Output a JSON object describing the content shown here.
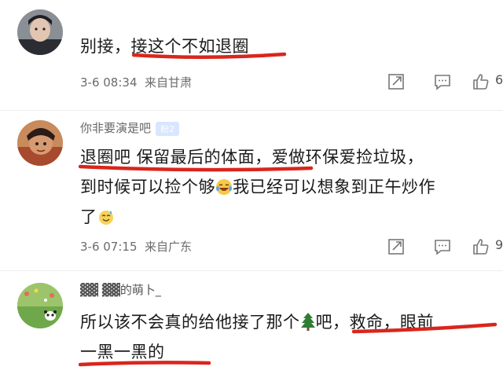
{
  "comments": [
    {
      "username": "",
      "text_lines": [
        "别接，接这个不如退圈"
      ],
      "time": "3-6 08:34",
      "location": "来自甘肃",
      "likes": "6"
    },
    {
      "username": "你非要演是吧",
      "fan_badge": "粉2",
      "text_lines": [
        "退圈吧 保留最后的体面，爱做环保爱捡垃圾，",
        "到时候可以捡个够",
        "我已经可以想象到正午炒作",
        "了"
      ],
      "time": "3-6 07:15",
      "location": "来自广东",
      "likes": "9"
    },
    {
      "username": "▓▓ ▓▓的萌卜_",
      "text_lines": [
        "所以该不会真的给他接了那个",
        "吧，救命，眼前",
        "一黑一黑的"
      ]
    }
  ],
  "colors": {
    "underline_red": "#d9261c",
    "meta_gray": "#6b6b6b",
    "text_dark": "#1a1a1a"
  },
  "icons": [
    "share-icon",
    "comment-icon",
    "like-icon",
    "laugh-cry-emoji",
    "tree-emoji"
  ]
}
